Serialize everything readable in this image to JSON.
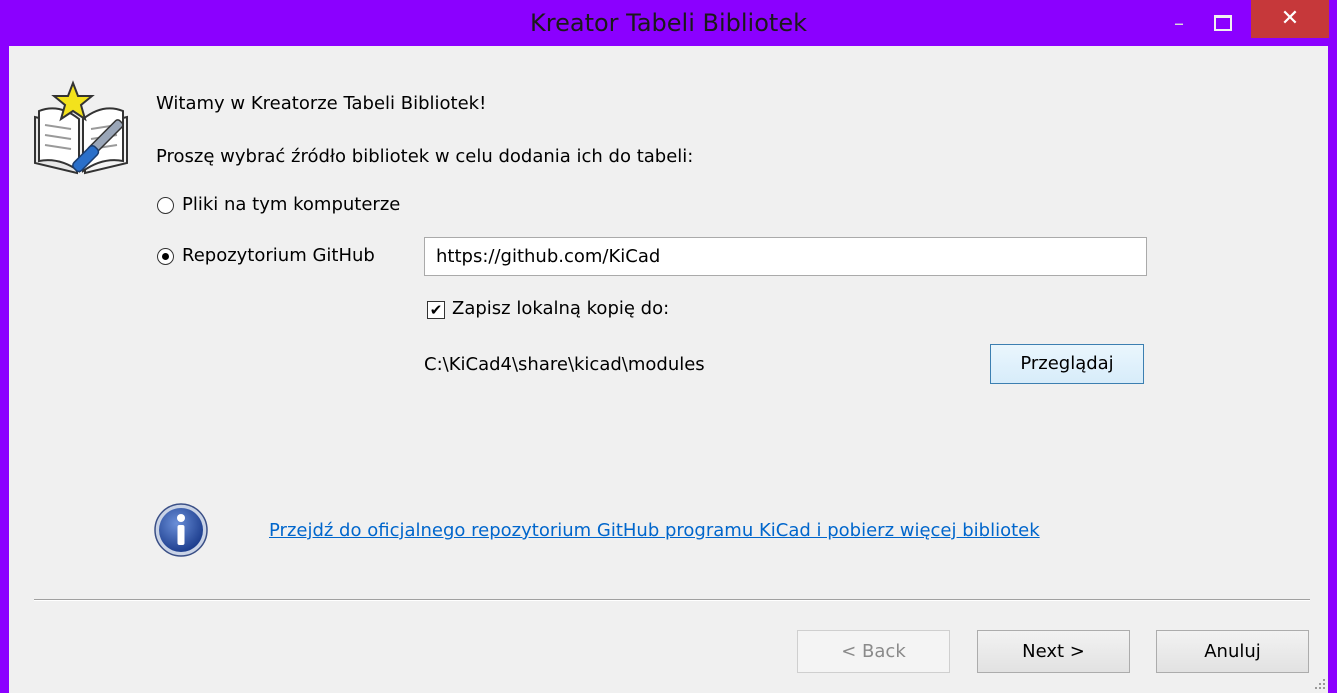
{
  "window": {
    "title": "Kreator Tabeli Bibliotek",
    "close_symbol": "✕",
    "minimize_symbol": "–"
  },
  "content": {
    "welcome": "Witamy w Kreatorze Tabeli Bibliotek!",
    "prompt": "Proszę wybrać źródło bibliotek w celu dodania ich do tabeli:",
    "source_options": [
      {
        "label": "Pliki na tym komputerze",
        "selected": false
      },
      {
        "label": "Repozytorium GitHub",
        "selected": true
      }
    ],
    "github_url": "https://github.com/KiCad",
    "save_local_copy": {
      "label": "Zapisz lokalną kopię do:",
      "checked": true,
      "mark": "✔"
    },
    "local_path": "C:\\KiCad4\\share\\kicad\\modules",
    "browse_label": "Przeglądaj",
    "info_link": "Przejdź do oficjalnego repozytorium GitHub programu KiCad i pobierz więcej bibliotek"
  },
  "footer": {
    "back_label": "< Back",
    "next_label": "Next >",
    "cancel_label": "Anuluj"
  },
  "colors": {
    "titlebar": "#8b00ff",
    "close": "#c6383a",
    "link": "#0066cc",
    "dialog_bg": "#f0f0f0"
  },
  "icons": [
    "wizard-book-icon",
    "info-icon",
    "resize-grip-icon"
  ]
}
